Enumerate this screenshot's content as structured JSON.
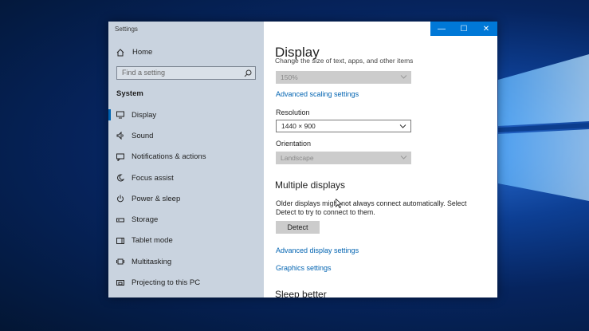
{
  "window": {
    "title": "Settings",
    "controls": [
      "—",
      "☐",
      "✕"
    ]
  },
  "sidebar": {
    "home_label": "Home",
    "search_placeholder": "Find a setting",
    "section_label": "System",
    "items": [
      {
        "label": "Display",
        "icon": "monitor-icon",
        "active": true
      },
      {
        "label": "Sound",
        "icon": "speaker-icon"
      },
      {
        "label": "Notifications & actions",
        "icon": "message-icon"
      },
      {
        "label": "Focus assist",
        "icon": "moon-icon"
      },
      {
        "label": "Power & sleep",
        "icon": "power-icon"
      },
      {
        "label": "Storage",
        "icon": "storage-icon"
      },
      {
        "label": "Tablet mode",
        "icon": "tablet-icon"
      },
      {
        "label": "Multitasking",
        "icon": "multitasking-icon"
      },
      {
        "label": "Projecting to this PC",
        "icon": "project-icon"
      }
    ]
  },
  "main": {
    "title": "Display",
    "scale_text_cut": "Change the size of text, apps, and other items",
    "scale_value": "150%",
    "advanced_scaling_link": "Advanced scaling settings",
    "resolution_label": "Resolution",
    "resolution_value": "1440 × 900",
    "orientation_label": "Orientation",
    "orientation_value": "Landscape",
    "multiple_heading": "Multiple displays",
    "multiple_desc": "Older displays might not always connect automatically. Select Detect to try to connect to them.",
    "detect_button": "Detect",
    "advanced_display_link": "Advanced display settings",
    "graphics_link": "Graphics settings",
    "sleep_heading": "Sleep better"
  },
  "colors": {
    "accent": "#0078d7",
    "link": "#0063b1",
    "sidebar_bg": "#c9d3df"
  }
}
